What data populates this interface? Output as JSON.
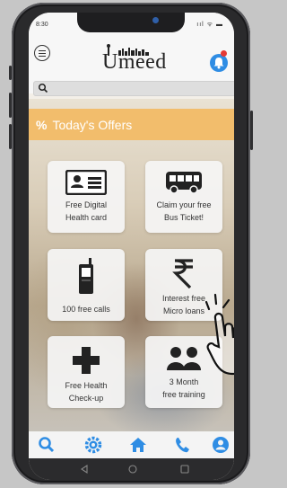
{
  "status": {
    "time": "8:30",
    "icons": "ııl ᯤ ▬"
  },
  "brand": {
    "name": "Umeed"
  },
  "search": {
    "placeholder": ""
  },
  "offers": {
    "icon": "%",
    "title": "Today's Offers"
  },
  "cards": [
    {
      "icon": "id-card-icon",
      "line1": "Free Digital",
      "line2": "Health card"
    },
    {
      "icon": "bus-icon",
      "line1": "Claim your free",
      "line2": "Bus Ticket!"
    },
    {
      "icon": "phone-icon",
      "line1": "100 free calls",
      "line2": ""
    },
    {
      "icon": "rupee-icon",
      "line1": "Interest free",
      "line2": "Micro loans"
    },
    {
      "icon": "medical-cross-icon",
      "line1": "Free Health",
      "line2": "Check-up"
    },
    {
      "icon": "people-icon",
      "line1": "3 Month",
      "line2": "free training"
    }
  ],
  "nav": [
    "search-icon",
    "settings-icon",
    "home-icon",
    "call-icon",
    "profile-icon"
  ],
  "colors": {
    "accent": "#2f8de4",
    "offers_bar": "#f2bd6c",
    "bell_dot": "#e53935"
  }
}
